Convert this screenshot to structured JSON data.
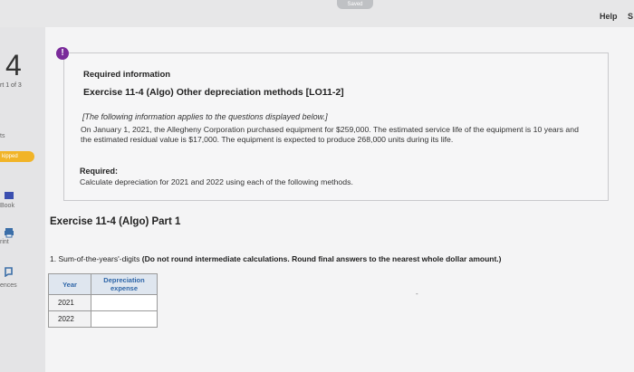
{
  "header": {
    "saved": "Saved",
    "help": "Help",
    "help_overflow": "S"
  },
  "sidebar": {
    "question_number": "4",
    "part_of": "rt 1 of 3",
    "items": [
      {
        "label": "ts"
      },
      {
        "label": "kipped"
      },
      {
        "label": "Book"
      },
      {
        "label": "rint"
      },
      {
        "label": "ences"
      }
    ]
  },
  "info": {
    "heading": "Required information",
    "exercise": "Exercise 11-4 (Algo) Other depreciation methods [LO11-2]",
    "note": "[The following information applies to the questions displayed below.]",
    "body": "On January 1, 2021, the Allegheny Corporation purchased equipment for $259,000. The estimated service life of the equipment is 10 years and the estimated residual value is $17,000. The equipment is expected to produce 268,000 units during its life.",
    "required_label": "Required:",
    "required_text": "Calculate depreciation for 2021 and 2022 using each of the following methods."
  },
  "part": {
    "title": "Exercise 11-4 (Algo) Part 1",
    "question_main": "1. Sum-of-the-years'-digits ",
    "question_bold": "(Do not round intermediate calculations. Round final answers to the nearest whole dollar amount.)"
  },
  "table": {
    "col_year": "Year",
    "col_dep": "Depreciation expense",
    "rows": [
      {
        "year": "2021",
        "value": ""
      },
      {
        "year": "2022",
        "value": ""
      }
    ]
  },
  "misc": {
    "dash": "-"
  }
}
